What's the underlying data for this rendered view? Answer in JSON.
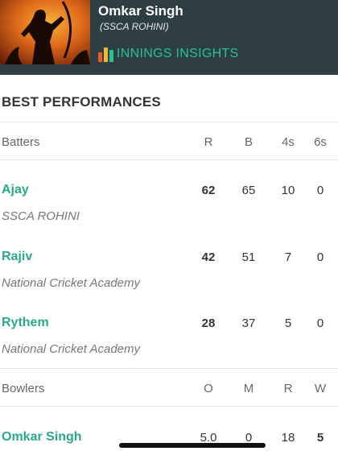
{
  "header": {
    "player_name": "Omkar Singh",
    "team": "(SSCA ROHINI)",
    "insights_label": "INNINGS INSIGHTS",
    "bg_color": "#2e3f44",
    "accent_color": "#2bbf9a",
    "insights_icon": "bar-chart-icon"
  },
  "section_title": "BEST PERFORMANCES",
  "batters": {
    "label": "Batters",
    "columns": [
      "R",
      "B",
      "4s",
      "6s"
    ],
    "rows": [
      {
        "name": "Ajay",
        "team": "SSCA ROHINI",
        "stats": [
          "62",
          "65",
          "10",
          "0"
        ]
      },
      {
        "name": "Rajiv",
        "team": "National Cricket Academy",
        "stats": [
          "42",
          "51",
          "7",
          "0"
        ]
      },
      {
        "name": "Rythem",
        "team": "National Cricket Academy",
        "stats": [
          "28",
          "37",
          "5",
          "0"
        ]
      }
    ]
  },
  "bowlers": {
    "label": "Bowlers",
    "columns": [
      "O",
      "M",
      "R",
      "W"
    ],
    "rows": [
      {
        "name": "Omkar Singh",
        "stats": [
          "5.0",
          "0",
          "18",
          "5"
        ]
      }
    ]
  }
}
